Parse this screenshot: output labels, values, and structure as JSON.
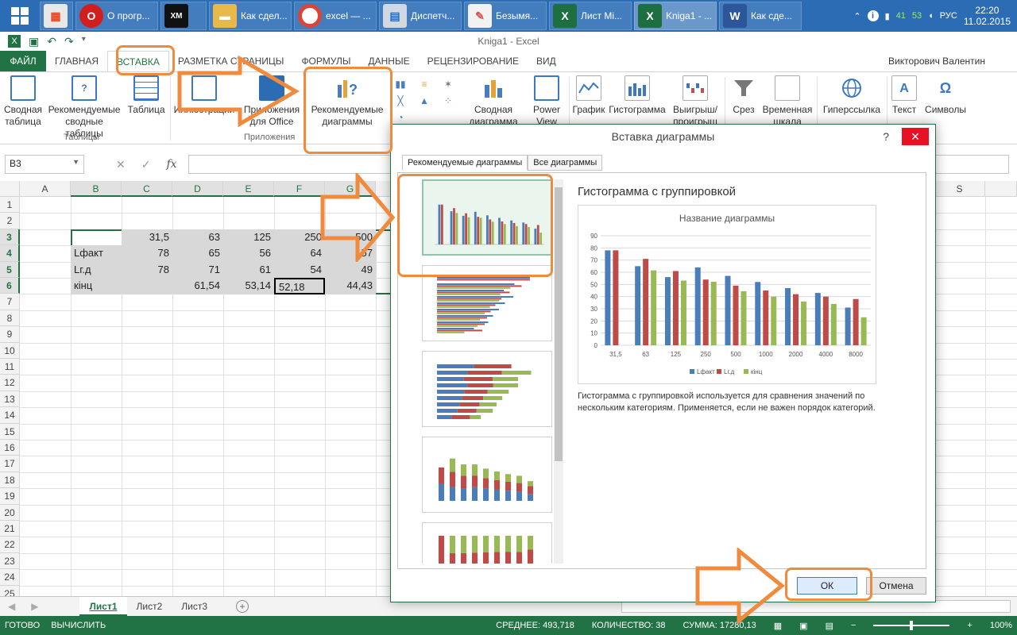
{
  "taskbar": {
    "items": [
      {
        "icon": "opera-icon",
        "label": "О прогр..."
      },
      {
        "icon": "xmplay-icon",
        "label": ""
      },
      {
        "icon": "folder-icon",
        "label": "Как сдел..."
      },
      {
        "icon": "chrome-icon",
        "label": "excel — ..."
      },
      {
        "icon": "task-manager-icon",
        "label": "Диспетч..."
      },
      {
        "icon": "paint-icon",
        "label": "Безымя..."
      },
      {
        "icon": "excel-icon",
        "label": "Лист Mi..."
      },
      {
        "icon": "excel-icon",
        "label": "Kniga1 - ..."
      },
      {
        "icon": "word-icon",
        "label": "Как сде..."
      }
    ],
    "tray": {
      "num1": "41",
      "num2": "53",
      "lang": "РУС",
      "time": "22:20",
      "date": "11.02.2015"
    }
  },
  "window": {
    "title": "Kniga1 - Excel",
    "user": "Викторович Валентин"
  },
  "ribbon_tabs": [
    "ФАЙЛ",
    "ГЛАВНАЯ",
    "ВСТАВКА",
    "РАЗМЕТКА СТРАНИЦЫ",
    "ФОРМУЛЫ",
    "ДАННЫЕ",
    "РЕЦЕНЗИРОВАНИЕ",
    "ВИД"
  ],
  "ribbon": {
    "pivot": "Сводная таблица",
    "recommended_pivot": "Рекомендуемые сводные таблицы",
    "table": "Таблица",
    "tables_group": "Таблицы",
    "illustrations": "Иллюстрации",
    "apps_for_office": "Приложения для Office",
    "apps_group": "Приложения",
    "recommended_charts": "Рекомендуемые диаграммы",
    "pivot_chart": "Сводная диаграмма",
    "power_view": "Power View",
    "line_chart": "График",
    "column_chart": "Гистограмма",
    "winloss": "Выигрыш/ проигрыш",
    "slicer": "Срез",
    "timeline": "Временная шкала",
    "hyperlink": "Гиперссылка",
    "text": "Текст",
    "symbols": "Символы"
  },
  "formula_bar": {
    "name_box": "B3",
    "fx": "fx"
  },
  "columns": [
    "A",
    "B",
    "C",
    "D",
    "E",
    "F",
    "G"
  ],
  "column_s": "S",
  "rows": [
    "1",
    "2",
    "3",
    "4",
    "5",
    "6",
    "7",
    "8",
    "9",
    "10",
    "11",
    "12",
    "13",
    "14",
    "15",
    "16",
    "17",
    "18",
    "19",
    "20",
    "21",
    "22",
    "23",
    "24",
    "25"
  ],
  "cells": {
    "r3": [
      "",
      "31,5",
      "63",
      "125",
      "250",
      "500"
    ],
    "r4": [
      "Lфакт",
      "78",
      "65",
      "56",
      "64",
      "57"
    ],
    "r5": [
      "Lг.д",
      "78",
      "71",
      "61",
      "54",
      "49"
    ],
    "r6": [
      "кінц",
      "",
      "61,54",
      "53,14",
      "52,18",
      "44,43"
    ]
  },
  "sheet_tabs": [
    "Лист1",
    "Лист2",
    "Лист3"
  ],
  "status": {
    "ready": "ГОТОВО",
    "calc": "ВЫЧИСЛИТЬ",
    "average": "СРЕДНЕЕ: 493,718",
    "count": "КОЛИЧЕСТВО: 38",
    "sum": "СУММА: 17280,13",
    "zoom": "100%"
  },
  "dialog": {
    "title": "Вставка диаграммы",
    "help": "?",
    "tab_recommended": "Рекомендуемые диаграммы",
    "tab_all": "Все диаграммы",
    "preview_title": "Гистограмма с группировкой",
    "description": "Гистограмма с группировкой используется для сравнения значений по нескольким категориям. Применяется, если не важен порядок категорий.",
    "ok": "ОК",
    "cancel": "Отмена"
  },
  "chart_data": {
    "type": "bar",
    "title": "Название диаграммы",
    "categories": [
      "31,5",
      "63",
      "125",
      "250",
      "500",
      "1000",
      "2000",
      "4000",
      "8000"
    ],
    "series": [
      {
        "name": "Lфакт",
        "values": [
          78,
          65,
          56,
          64,
          57,
          52,
          47,
          43,
          31
        ],
        "color": "#4a7ebb"
      },
      {
        "name": "Lг.д",
        "values": [
          78,
          71,
          61,
          54,
          49,
          45,
          42,
          40,
          38
        ],
        "color": "#be4b48"
      },
      {
        "name": "кінц",
        "values": [
          null,
          61.54,
          53.14,
          52.18,
          44.43,
          40,
          36,
          34,
          23
        ],
        "color": "#98b954"
      }
    ],
    "ylim": [
      0,
      90
    ],
    "yticks": [
      0,
      10,
      20,
      30,
      40,
      50,
      60,
      70,
      80,
      90
    ],
    "legend": "bottom",
    "grid": true
  },
  "colors": {
    "excel_green": "#217346",
    "highlight_orange": "#f08a3c",
    "taskbar_blue": "#2b6cb4"
  }
}
